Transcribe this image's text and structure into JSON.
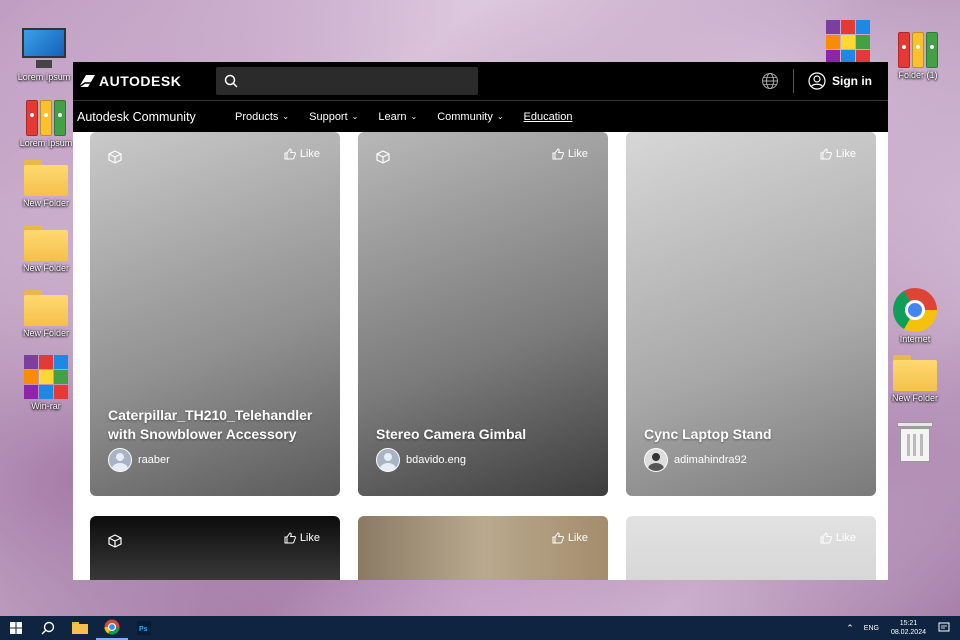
{
  "desktop": {
    "icons_left": [
      {
        "label": "Lorem Ipsum",
        "icon": "monitor-icon"
      },
      {
        "label": "Lorem Ipsum",
        "icon": "binders-icon"
      },
      {
        "label": "New Folder",
        "icon": "folder-icon"
      },
      {
        "label": "New Folder",
        "icon": "folder-icon"
      },
      {
        "label": "New Folder",
        "icon": "folder-icon"
      },
      {
        "label": "Win-rar",
        "icon": "winrar-icon"
      }
    ],
    "icons_right": [
      {
        "label": "",
        "icon": "winrar-icon"
      },
      {
        "label": "Folder (1)",
        "icon": "binders-icon"
      },
      {
        "label": "Internet",
        "icon": "chrome-icon"
      },
      {
        "label": "New Folder",
        "icon": "folder-icon"
      },
      {
        "label": "",
        "icon": "recycle-bin-icon"
      }
    ]
  },
  "browser": {
    "header": {
      "logo_text": "AUTODESK",
      "search_placeholder": "",
      "sign_in_label": "Sign in"
    },
    "subnav": {
      "title": "Autodesk Community",
      "items": [
        {
          "label": "Products",
          "dropdown": true
        },
        {
          "label": "Support",
          "dropdown": true
        },
        {
          "label": "Learn",
          "dropdown": true
        },
        {
          "label": "Community",
          "dropdown": true
        },
        {
          "label": "Education",
          "dropdown": false
        }
      ]
    },
    "cards": [
      {
        "title": "Caterpillar_TH210_Telehandler with Snowblower Accessory",
        "author": "raaber",
        "like_label": "Like"
      },
      {
        "title": "Stereo Camera Gimbal",
        "author": "bdavido.eng",
        "like_label": "Like"
      },
      {
        "title": "Cync Laptop Stand",
        "author": "adimahindra92",
        "like_label": "Like"
      },
      {
        "title": "",
        "author": "",
        "like_label": "Like"
      },
      {
        "title": "",
        "author": "",
        "like_label": "Like"
      },
      {
        "title": "",
        "author": "",
        "like_label": "Like"
      }
    ]
  },
  "taskbar": {
    "language": "ENG",
    "time": "15:21",
    "date": "08.02.2024"
  },
  "colors": {
    "header_bg": "#000000",
    "taskbar_bg": "#0e2440"
  }
}
